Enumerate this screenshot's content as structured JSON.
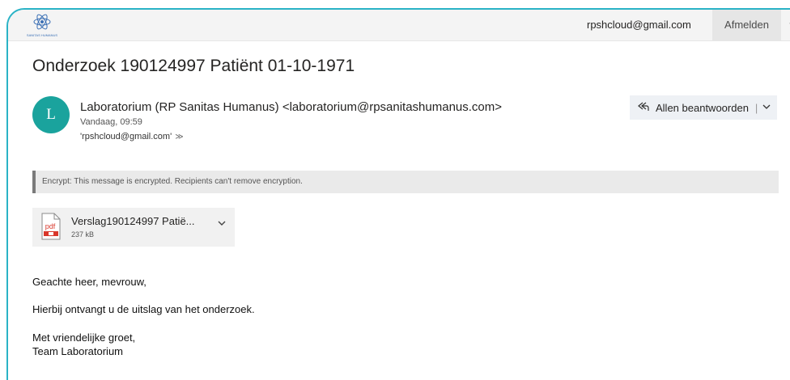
{
  "header": {
    "logo_text": "SANITAS HUMANUS",
    "account": "rpshcloud@gmail.com",
    "signout_label": "Afmelden",
    "help_label": "?"
  },
  "message": {
    "subject": "Onderzoek 190124997 Patiënt 01-10-1971",
    "avatar_initial": "L",
    "avatar_color": "#1aa39d",
    "sender": "Laboratorium (RP Sanitas Humanus) <laboratorium@rpsanitashumanus.com>",
    "date": "Vandaag, 09:59",
    "recipients": "'rpshcloud@gmail.com'",
    "reply_all_label": "Allen beantwoorden",
    "encryption_notice": "Encrypt: This message is encrypted. Recipients can't remove encryption."
  },
  "attachment": {
    "name": "Verslag190124997 Patië...",
    "size": "237 kB",
    "icon": "pdf-file-icon"
  },
  "body": {
    "greeting": "Geachte heer, mevrouw,",
    "line1": "Hierbij ontvangt u de uitslag van het onderzoek.",
    "closing": "Met vriendelijke groet,",
    "signature": "Team Laboratorium"
  },
  "colors": {
    "accent_frame": "#2ab3c6",
    "pdf_red": "#d9372b"
  }
}
